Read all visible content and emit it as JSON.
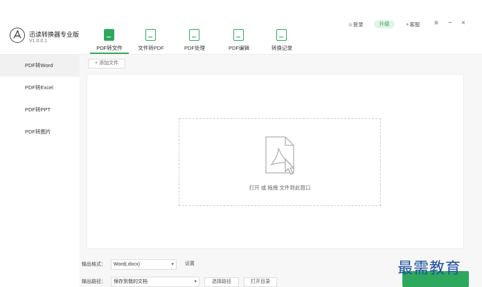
{
  "app": {
    "name": "迅读转换器专业版",
    "version": "V1.0.0.1"
  },
  "header": {
    "login": "登录",
    "upgrade": "升级",
    "service": "客服",
    "menu_icon": "hamburger-icon",
    "minimize_icon": "minimize-icon",
    "close_icon": "close-icon"
  },
  "tabs": [
    {
      "label": "PDF转文件",
      "icon": "pdf-convert-icon",
      "active": true
    },
    {
      "label": "文件转PDF",
      "icon": "file-to-pdf-icon",
      "active": false
    },
    {
      "label": "PDF处理",
      "icon": "pdf-process-icon",
      "active": false
    },
    {
      "label": "PDF编辑",
      "icon": "pdf-edit-icon",
      "active": false
    },
    {
      "label": "转换记录",
      "icon": "history-icon",
      "active": false
    }
  ],
  "sidebar": {
    "items": [
      {
        "label": "PDF转Word",
        "active": true
      },
      {
        "label": "PDF转Excel",
        "active": false
      },
      {
        "label": "PDF转PPT",
        "active": false
      },
      {
        "label": "PDF转图片",
        "active": false
      }
    ]
  },
  "main": {
    "add_file": "+ 添加文件",
    "drop_text": "打开 或 拖拽 文件到此窗口",
    "output_format_label": "输出格式：",
    "output_format_value": "Word(.docx)",
    "settings": "设置",
    "output_path_label": "输出路径：",
    "output_path_value": "保存到我的文档",
    "choose_path": "选择路径",
    "open_folder": "打开目录"
  },
  "watermark": "最需教育",
  "colors": {
    "accent": "#2ea85c"
  }
}
